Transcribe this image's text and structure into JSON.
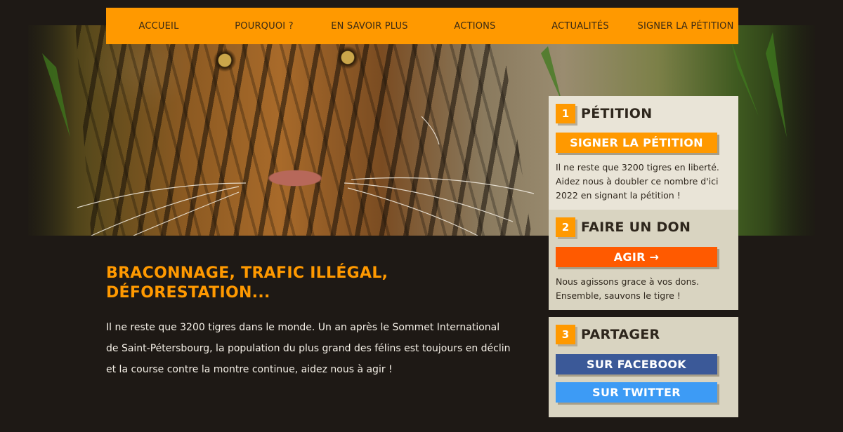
{
  "nav": {
    "items": [
      "ACCUEIL",
      "POURQUOI ?",
      "EN SAVOIR PLUS",
      "ACTIONS",
      "ACTUALITÉS",
      "SIGNER LA PÉTITION"
    ]
  },
  "main": {
    "headline": "BRACONNAGE, TRAFIC ILLÉGAL, DÉFORESTATION...",
    "text": "Il ne reste que 3200 tigres dans le monde. Un an après le Sommet International de Saint-Pétersbourg, la population du plus grand des félins est toujours en déclin et la course contre la montre continue, aidez nous à agir !"
  },
  "sidebar": {
    "petition": {
      "step": "1",
      "title": "PÉTITION",
      "button": "SIGNER LA PÉTITION",
      "text": "Il ne reste que 3200 tigres en liberté. Aidez nous à doubler ce nombre d'ici 2022 en signant la pétition !"
    },
    "don": {
      "step": "2",
      "title": "FAIRE UN DON",
      "button": "AGIR →",
      "text": "Nous agissons grace à vos dons. Ensemble, sauvons le tigre !"
    },
    "share": {
      "step": "3",
      "title": "PARTAGER",
      "facebook": "SUR FACEBOOK",
      "twitter": "SUR TWITTER"
    }
  },
  "colors": {
    "accent": "#ff9900",
    "background": "#1e1915",
    "don_button": "#ff5a00",
    "facebook": "#3b5998",
    "twitter": "#3d9bf5"
  }
}
